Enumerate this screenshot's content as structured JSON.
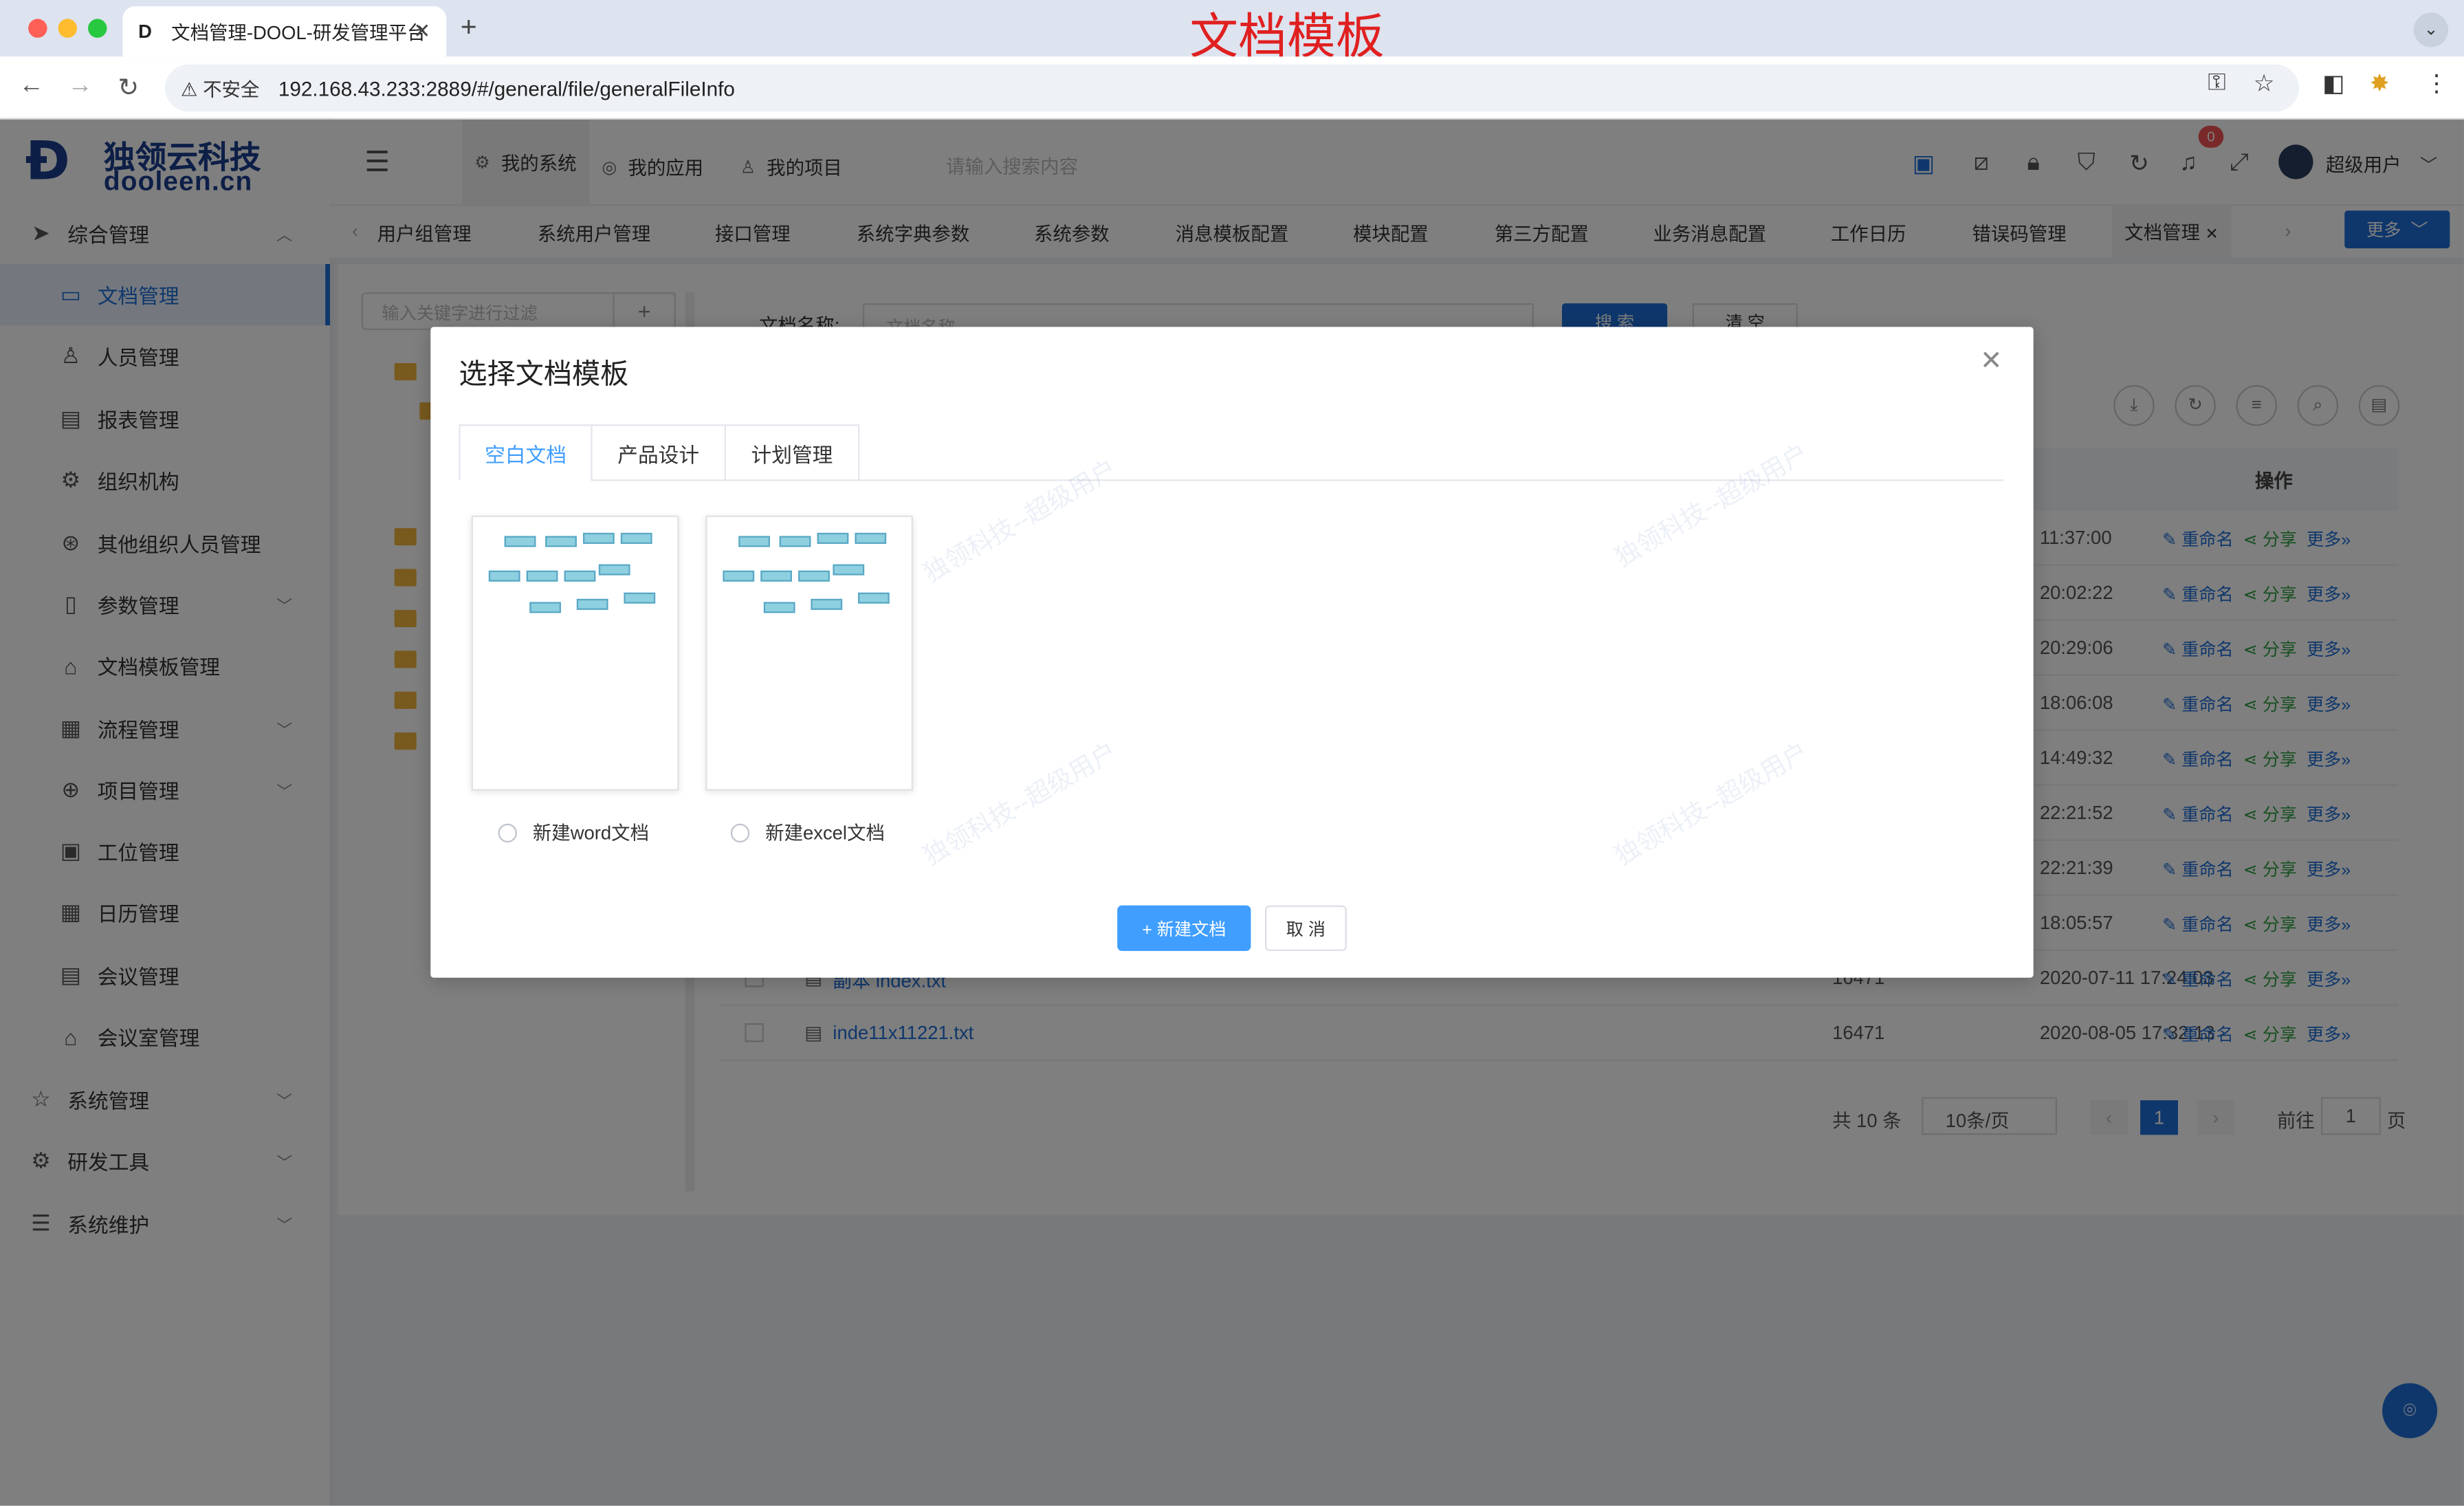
{
  "browser": {
    "tab_title": "文档管理-DOOL-研发管理平台",
    "annotation": "文档模板",
    "insecure_label": "不安全",
    "url": "192.168.43.233:2889/#/general/file/generalFileInfo"
  },
  "logo": {
    "cn": "独领云科技",
    "en": "dooleen.cn"
  },
  "sidebar": {
    "items": [
      {
        "label": "综合管理",
        "icon": "send-icon"
      },
      {
        "label": "文档管理",
        "icon": "folder-icon"
      },
      {
        "label": "人员管理",
        "icon": "user-icon"
      },
      {
        "label": "报表管理",
        "icon": "report-icon"
      },
      {
        "label": "组织机构",
        "icon": "gear-icon"
      },
      {
        "label": "其他组织人员管理",
        "icon": "org-icon"
      },
      {
        "label": "参数管理",
        "icon": "param-icon"
      },
      {
        "label": "文档模板管理",
        "icon": "template-icon"
      },
      {
        "label": "流程管理",
        "icon": "calendar-icon"
      },
      {
        "label": "项目管理",
        "icon": "plus-circle-icon"
      },
      {
        "label": "工位管理",
        "icon": "clipboard-icon"
      },
      {
        "label": "日历管理",
        "icon": "calendar-icon"
      },
      {
        "label": "会议管理",
        "icon": "doc-icon"
      },
      {
        "label": "会议室管理",
        "icon": "home-icon"
      },
      {
        "label": "系统管理",
        "icon": "star-icon"
      },
      {
        "label": "研发工具",
        "icon": "settings-icon"
      },
      {
        "label": "系统维护",
        "icon": "sliders-icon"
      }
    ]
  },
  "header": {
    "tabs": [
      "我的系统",
      "我的应用",
      "我的项目"
    ],
    "search_placeholder": "请输入搜索内容",
    "notif_count": "0",
    "user": "超级用户"
  },
  "pagetabs": [
    "用户组管理",
    "系统用户管理",
    "接口管理",
    "系统字典参数",
    "系统参数",
    "消息模板配置",
    "模块配置",
    "第三方配置",
    "业务消息配置",
    "工作日历",
    "错误码管理",
    "文档管理"
  ],
  "more_label": "更多",
  "bg": {
    "tree_placeholder": "输入关键字进行过滤",
    "filter_label": "文档名称:",
    "filter_placeholder": "文档名称",
    "search_btn": "搜 索",
    "clear_btn": "清 空",
    "ops_header": "操作",
    "rows": [
      {
        "name": "",
        "size": "",
        "time": "11:37:00"
      },
      {
        "name": "",
        "size": "",
        "time": "20:02:22"
      },
      {
        "name": "",
        "size": "",
        "time": "20:29:06"
      },
      {
        "name": "",
        "size": "",
        "time": "18:06:08"
      },
      {
        "name": "",
        "size": "",
        "time": "14:49:32"
      },
      {
        "name": "",
        "size": "",
        "time": "22:21:52"
      },
      {
        "name": "",
        "size": "",
        "time": "22:21:39"
      },
      {
        "name": "",
        "size": "",
        "time": "18:05:57"
      },
      {
        "name": "副本 index.txt",
        "size": "16471",
        "time": "2020-07-11 17:24:03"
      },
      {
        "name": "inde11x11221.txt",
        "size": "16471",
        "time": "2020-08-05 17:32:13"
      }
    ],
    "op_rename": "重命名",
    "op_share": "分享",
    "op_more": "更多",
    "pager": {
      "total": "共 10 条",
      "size": "10条/页",
      "current": "1",
      "goto": "前往",
      "goto_val": "1",
      "page_unit": "页"
    }
  },
  "modal": {
    "title": "选择文档模板",
    "tabs": [
      "空白文档",
      "产品设计",
      "计划管理"
    ],
    "options": [
      "新建word文档",
      "新建excel文档"
    ],
    "confirm": "+ 新建文档",
    "cancel": "取 消",
    "watermark": "独领科技--超级用户"
  }
}
